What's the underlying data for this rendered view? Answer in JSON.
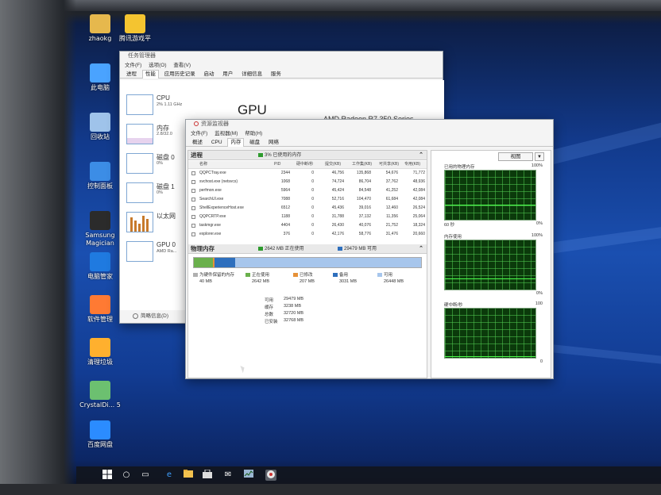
{
  "desktop_icons": [
    {
      "label": "zhaokg",
      "icon": "folder-icon",
      "color": "#e6b84d"
    },
    {
      "label": "腾讯游戏平",
      "icon": "tencent-games-icon",
      "color": "#f4c430"
    },
    {
      "label": "此电脑",
      "icon": "computer-icon",
      "color": "#4aa3ff"
    },
    {
      "label": "回收站",
      "icon": "recycle-bin-icon",
      "color": "#9fc3ea"
    },
    {
      "label": "控制面板",
      "icon": "control-panel-icon",
      "color": "#3c8de6"
    },
    {
      "label": "Samsung Magician",
      "icon": "samsung-magician-icon",
      "color": "#2b2b2b"
    },
    {
      "label": "电脑管家",
      "icon": "pc-manager-icon",
      "color": "#1f7ae0"
    },
    {
      "label": "软件管理",
      "icon": "software-manager-icon",
      "color": "#ff7a33"
    },
    {
      "label": "清理垃圾",
      "icon": "clean-junk-icon",
      "color": "#ffb02e"
    },
    {
      "label": "CrystalDi... 5",
      "icon": "crystaldisk-icon",
      "color": "#6cc070"
    },
    {
      "label": "百度网盘",
      "icon": "baidu-netdisk-icon",
      "color": "#2b8cff"
    }
  ],
  "task_manager": {
    "title": "任务管理器",
    "menu": [
      "文件(F)",
      "选项(O)",
      "查看(V)"
    ],
    "tabs": [
      "进程",
      "性能",
      "应用历史记录",
      "启动",
      "用户",
      "详细信息",
      "服务"
    ],
    "active_tab": 1,
    "perf_items": [
      {
        "name": "CPU",
        "sub": "2% 1.11 GHz"
      },
      {
        "name": "内存",
        "sub": "2.8/32.0"
      },
      {
        "name": "磁盘 0",
        "sub": "0%"
      },
      {
        "name": "磁盘 1",
        "sub": "0%"
      },
      {
        "name": "以太网",
        "sub": ""
      },
      {
        "name": "GPU 0",
        "sub": "AMD Ra..."
      }
    ],
    "gpu_heading": "GPU",
    "gpu_model": "AMD Radeon R7 350 Series",
    "footer": "简略信息(D)"
  },
  "resource_monitor": {
    "title": "资源监视器",
    "menu": [
      "文件(F)",
      "监视器(M)",
      "帮助(H)"
    ],
    "tabs": [
      "概述",
      "CPU",
      "内存",
      "磁盘",
      "网络"
    ],
    "active_tab": 2,
    "processes_header": "进程",
    "processes_badge": "3% 已使用的内存",
    "columns": [
      "名称",
      "PID",
      "硬中断/秒",
      "提交(KB)",
      "工作集(KB)",
      "可共享(KB)",
      "专用(KB)"
    ],
    "rows": [
      {
        "name": "QQPCTray.exe",
        "pid": "2344",
        "hf": "0",
        "commit": "46,756",
        "ws": "135,868",
        "share": "54,676",
        "priv": "71,772"
      },
      {
        "name": "svchost.exe (netsvcs)",
        "pid": "1068",
        "hf": "0",
        "commit": "74,724",
        "ws": "86,704",
        "share": "37,762",
        "priv": "48,936"
      },
      {
        "name": "perfmon.exe",
        "pid": "5964",
        "hf": "0",
        "commit": "45,424",
        "ws": "84,548",
        "share": "41,252",
        "priv": "42,084"
      },
      {
        "name": "SearchUI.exe",
        "pid": "7088",
        "hf": "0",
        "commit": "52,716",
        "ws": "104,470",
        "share": "61,684",
        "priv": "42,084"
      },
      {
        "name": "ShellExperienceHost.exe",
        "pid": "6512",
        "hf": "0",
        "commit": "45,436",
        "ws": "39,016",
        "share": "12,460",
        "priv": "26,524"
      },
      {
        "name": "QQPCRTP.exe",
        "pid": "1188",
        "hf": "0",
        "commit": "31,788",
        "ws": "37,132",
        "share": "11,356",
        "priv": "25,064"
      },
      {
        "name": "taskmgr.exe",
        "pid": "4404",
        "hf": "0",
        "commit": "26,430",
        "ws": "40,076",
        "share": "21,752",
        "priv": "18,324"
      },
      {
        "name": "explorer.exe",
        "pid": "376",
        "hf": "0",
        "commit": "42,176",
        "ws": "58,776",
        "share": "31,476",
        "priv": "20,660"
      }
    ],
    "memory_header": "物理内存",
    "memory_badge_used": "2642 MB 正在使用",
    "memory_badge_avail": "29479 MB 可用",
    "memory_legend": [
      {
        "label": "为硬件保留的内存",
        "value": "40 MB",
        "color": "#b0b0b0"
      },
      {
        "label": "正在使用",
        "value": "2642 MB",
        "color": "#6ab04c"
      },
      {
        "label": "已修改",
        "value": "207 MB",
        "color": "#e69138"
      },
      {
        "label": "备用",
        "value": "3031 MB",
        "color": "#2e6fbd"
      },
      {
        "label": "可用",
        "value": "26448 MB",
        "color": "#a7c6ec"
      }
    ],
    "memory_stats": [
      {
        "k": "可用",
        "v": "29479 MB"
      },
      {
        "k": "缓存",
        "v": "3238 MB"
      },
      {
        "k": "总数",
        "v": "32720 MB"
      },
      {
        "k": "已安装",
        "v": "32768 MB"
      }
    ],
    "view_label": "视图",
    "graphs": [
      {
        "title": "已用的物理内存",
        "top_right": "100%",
        "bottom_left": "60 秒",
        "bottom_right": "0%"
      },
      {
        "title": "内存使用",
        "top_right": "100%",
        "bottom_left": "",
        "bottom_right": "0%"
      },
      {
        "title": "硬中断/秒",
        "top_right": "100",
        "bottom_left": "",
        "bottom_right": "0"
      }
    ]
  },
  "taskbar_icons": [
    "windows-start-icon",
    "search-icon",
    "task-view-icon",
    "edge-icon",
    "file-explorer-icon",
    "store-icon",
    "mail-icon",
    "task-manager-icon",
    "resource-monitor-icon"
  ]
}
